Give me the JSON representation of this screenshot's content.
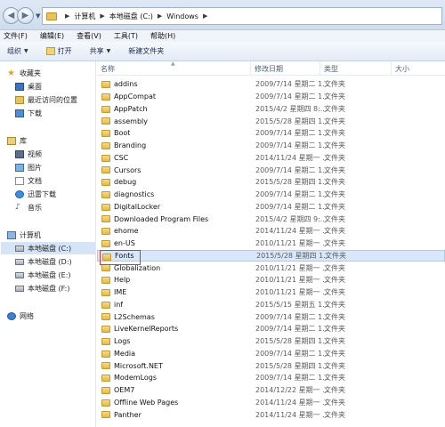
{
  "address": {
    "crumbs": [
      "计算机",
      "本地磁盘 (C:)",
      "Windows"
    ]
  },
  "menu": [
    "文件(F)",
    "编辑(E)",
    "查看(V)",
    "工具(T)",
    "帮助(H)"
  ],
  "toolbar": {
    "organize": "组织",
    "open": "打开",
    "share": "共享",
    "new_folder": "新建文件夹"
  },
  "nav": {
    "favorites": "收藏夹",
    "desktop": "桌面",
    "recent": "最近访问的位置",
    "downloads": "下载",
    "libraries": "库",
    "videos": "视频",
    "pictures": "图片",
    "documents": "文档",
    "thunder": "迅雷下载",
    "music": "音乐",
    "computer": "计算机",
    "drive_c": "本地磁盘 (C:)",
    "drive_d": "本地磁盘 (D:)",
    "drive_e": "本地磁盘 (E:)",
    "drive_f": "本地磁盘 (F:)",
    "network": "网络"
  },
  "columns": {
    "name": "名称",
    "date": "修改日期",
    "type": "类型",
    "size": "大小"
  },
  "files": [
    {
      "name": "addins",
      "date": "2009/7/14 星期二 1...",
      "type": "文件夹"
    },
    {
      "name": "AppCompat",
      "date": "2009/7/14 星期二 1...",
      "type": "文件夹"
    },
    {
      "name": "AppPatch",
      "date": "2015/4/2 星期四 8:...",
      "type": "文件夹"
    },
    {
      "name": "assembly",
      "date": "2015/5/28 星期四 1...",
      "type": "文件夹"
    },
    {
      "name": "Boot",
      "date": "2009/7/14 星期二 1...",
      "type": "文件夹"
    },
    {
      "name": "Branding",
      "date": "2009/7/14 星期二 1...",
      "type": "文件夹"
    },
    {
      "name": "CSC",
      "date": "2014/11/24 星期一 ...",
      "type": "文件夹"
    },
    {
      "name": "Cursors",
      "date": "2009/7/14 星期二 1...",
      "type": "文件夹"
    },
    {
      "name": "debug",
      "date": "2015/5/28 星期四 1...",
      "type": "文件夹"
    },
    {
      "name": "diagnostics",
      "date": "2009/7/14 星期二 1...",
      "type": "文件夹"
    },
    {
      "name": "DigitalLocker",
      "date": "2009/7/14 星期二 1...",
      "type": "文件夹"
    },
    {
      "name": "Downloaded Program Files",
      "date": "2015/4/2 星期四 9:...",
      "type": "文件夹"
    },
    {
      "name": "ehome",
      "date": "2014/11/24 星期一 ...",
      "type": "文件夹"
    },
    {
      "name": "en-US",
      "date": "2010/11/21 星期一 ...",
      "type": "文件夹"
    },
    {
      "name": "Fonts",
      "date": "2015/5/28 星期四 1...",
      "type": "文件夹",
      "selected": true
    },
    {
      "name": "Globalization",
      "date": "2010/11/21 星期一 ...",
      "type": "文件夹"
    },
    {
      "name": "Help",
      "date": "2010/11/21 星期一 ...",
      "type": "文件夹"
    },
    {
      "name": "IME",
      "date": "2010/11/21 星期一 ...",
      "type": "文件夹"
    },
    {
      "name": "inf",
      "date": "2015/5/15 星期五 1...",
      "type": "文件夹"
    },
    {
      "name": "L2Schemas",
      "date": "2009/7/14 星期二 1...",
      "type": "文件夹"
    },
    {
      "name": "LiveKernelReports",
      "date": "2009/7/14 星期二 1...",
      "type": "文件夹"
    },
    {
      "name": "Logs",
      "date": "2015/5/28 星期四 1...",
      "type": "文件夹"
    },
    {
      "name": "Media",
      "date": "2009/7/14 星期二 1...",
      "type": "文件夹"
    },
    {
      "name": "Microsoft.NET",
      "date": "2015/5/28 星期四 1...",
      "type": "文件夹"
    },
    {
      "name": "ModemLogs",
      "date": "2009/7/14 星期二 1...",
      "type": "文件夹"
    },
    {
      "name": "OEM7",
      "date": "2014/12/22 星期一 ...",
      "type": "文件夹"
    },
    {
      "name": "Offline Web Pages",
      "date": "2014/11/24 星期一 ...",
      "type": "文件夹"
    },
    {
      "name": "Panther",
      "date": "2014/11/24 星期一 ...",
      "type": "文件夹"
    }
  ]
}
